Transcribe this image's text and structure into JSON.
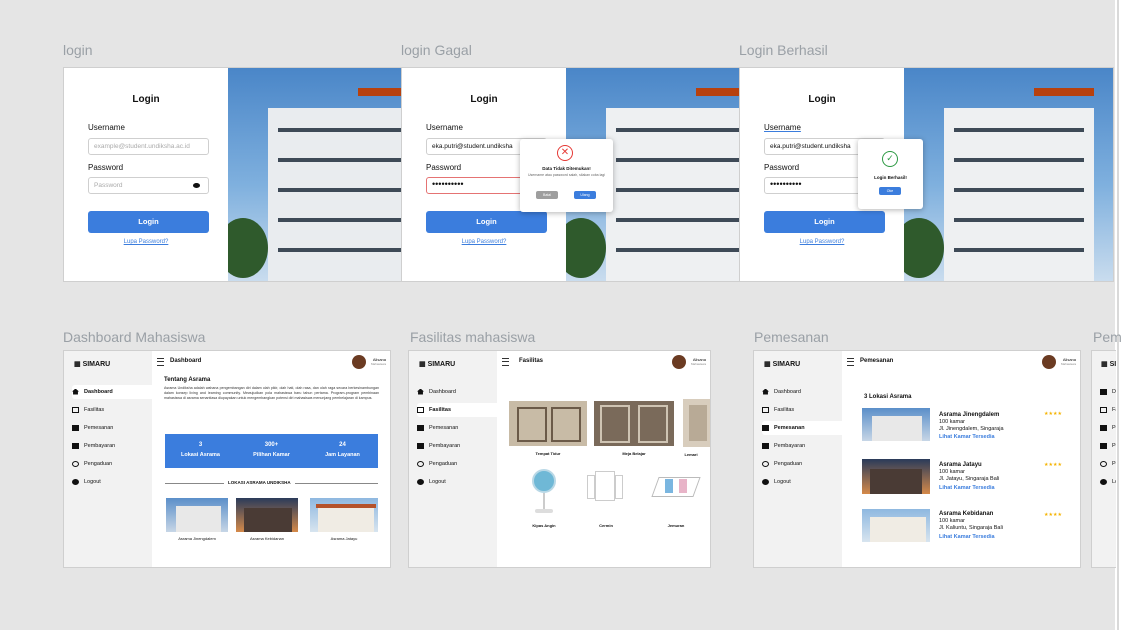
{
  "frames": {
    "login": {
      "label": "login"
    },
    "login_failed": {
      "label": "login Gagal"
    },
    "login_success": {
      "label": "Login Berhasil"
    },
    "dashboard": {
      "label": "Dashboard Mahasiswa"
    },
    "facilities": {
      "label": "Fasilitas mahasiswa"
    },
    "booking": {
      "label": "Pemesanan"
    },
    "partial": {
      "label": "Pem"
    }
  },
  "login_form": {
    "title": "Login",
    "username_label": "Username",
    "username_placeholder": "example@student.undiksha.ac.id",
    "username_value": "eka.putri@student.undiksha",
    "password_label": "Password",
    "password_placeholder": "Password",
    "password_value": "••••••••••",
    "submit_label": "Login",
    "forgot_label": "Lupa Password?"
  },
  "modal_failed": {
    "title": "Data Tidak Ditemukan!",
    "message": "Username atau password salah, silakan coba lagi",
    "cancel_label": "Batal",
    "retry_label": "Ulang"
  },
  "modal_success": {
    "title": "Login Berhasil!",
    "ok_label": "Oke"
  },
  "app": {
    "brand": "SIMARU",
    "user_name": "Alisana",
    "user_role": "Mahasiswa",
    "nav": [
      {
        "label": "Dashboard",
        "icon": "home-icon"
      },
      {
        "label": "Fasilitas",
        "icon": "building-icon"
      },
      {
        "label": "Pemesanan",
        "icon": "clipboard-icon"
      },
      {
        "label": "Pembayaran",
        "icon": "card-icon"
      },
      {
        "label": "Pengaduan",
        "icon": "support-icon"
      },
      {
        "label": "Logout",
        "icon": "logout-icon"
      }
    ]
  },
  "dashboard": {
    "page_title": "Dashboard",
    "about_title": "Tentang Asrama",
    "about_text": "Asrama Undiksha adalah wahana pengembangan diri dalam olah pikir, olah hati, olah rasa, dan olah raga secara berkesinambungan dalam konsep living and learning community. Mewujudkan pola mahasiswa baru tahun pertama. Program-program pembinaan mahasiswa di asrama senantiasa diupayakan untuk mengembangkan potensi diri mahasiswa menunjang pembelajaran di kampus.",
    "stats": [
      {
        "value": "3",
        "label": "Lokasi Asrama"
      },
      {
        "value": "300+",
        "label": "Pilihan Kamar"
      },
      {
        "value": "24",
        "label": "Jam Layanan"
      }
    ],
    "locations_title": "LOKASI ASRAMA UNDIKSHA",
    "locations": [
      "Asrama Jinengdalem",
      "Asrama Kebidanan",
      "Asrama Jatayu"
    ]
  },
  "facilities": {
    "page_title": "Fasilitas",
    "items": [
      "Tempat Tidur",
      "Meja Belajar",
      "Lemari",
      "Kipas Angin",
      "Cermin",
      "Jemuran"
    ]
  },
  "booking": {
    "page_title": "Pemesanan",
    "count_title": "3 Lokasi Asrama",
    "see_rooms_label": "Lihat Kamar Tersedia",
    "locations": [
      {
        "name": "Asrama Jinengdalem",
        "rooms": "100 kamar",
        "address": "Jl. Jinengdalem, Singaraja",
        "rating": "★★★★"
      },
      {
        "name": "Asrama Jatayu",
        "rooms": "100 kamar",
        "address": "Jl. Jatayu, Singaraja Bali",
        "rating": "★★★★"
      },
      {
        "name": "Asrama Kebidanan",
        "rooms": "100 kamar",
        "address": "Jl. Kaliuntu, Singaraja Bali",
        "rating": "★★★★"
      }
    ]
  },
  "colors": {
    "accent": "#3b7ddd",
    "error": "#e53935",
    "success": "#2e9a44"
  }
}
